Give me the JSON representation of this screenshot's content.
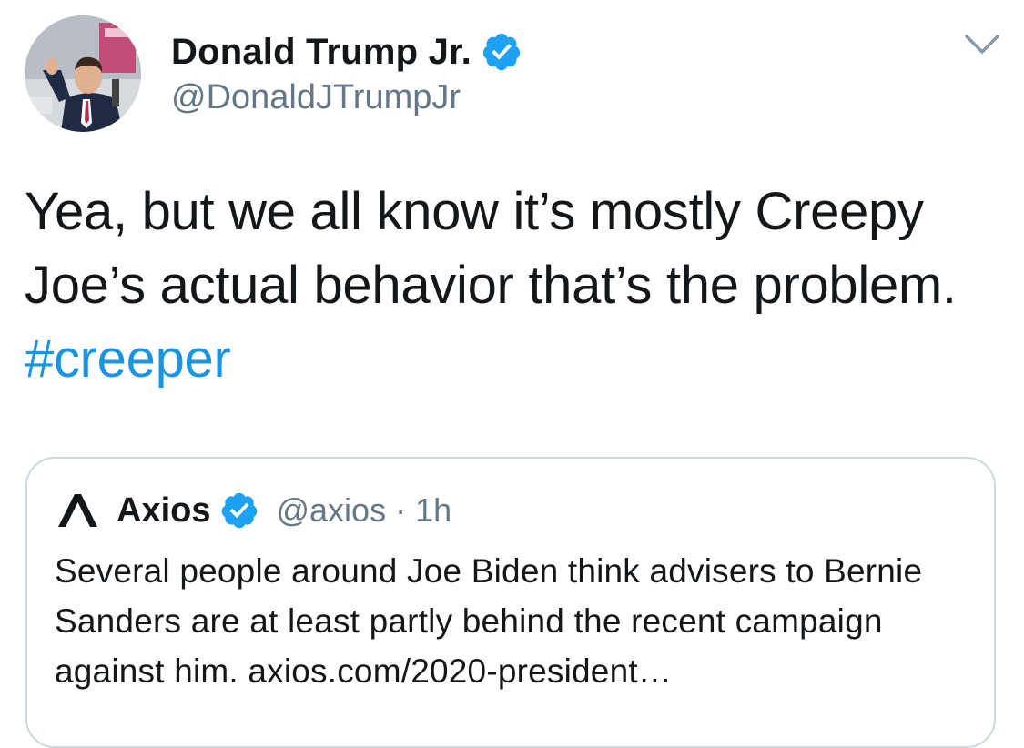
{
  "tweet": {
    "author": {
      "name": "Donald Trump Jr.",
      "handle": "@DonaldJTrumpJr",
      "verified": true
    },
    "text": "Yea, but we all know it’s mostly Creepy Joe’s actual behavior that’s the problem.",
    "hashtag": "#creeper",
    "menu_icon": "chevron-down-icon"
  },
  "quote": {
    "logo_icon": "axios-logo-icon",
    "name": "Axios",
    "verified": true,
    "handle": "@axios",
    "separator": "·",
    "time": "1h",
    "text": "Several people around Joe Biden think advisers to Bernie Sanders are at least partly behind the recent campaign against him. axios.com/2020-president…"
  },
  "colors": {
    "link": "#1b95e0",
    "verified": "#1da1f2",
    "secondary_text": "#657786",
    "border": "#ccd6dd"
  }
}
